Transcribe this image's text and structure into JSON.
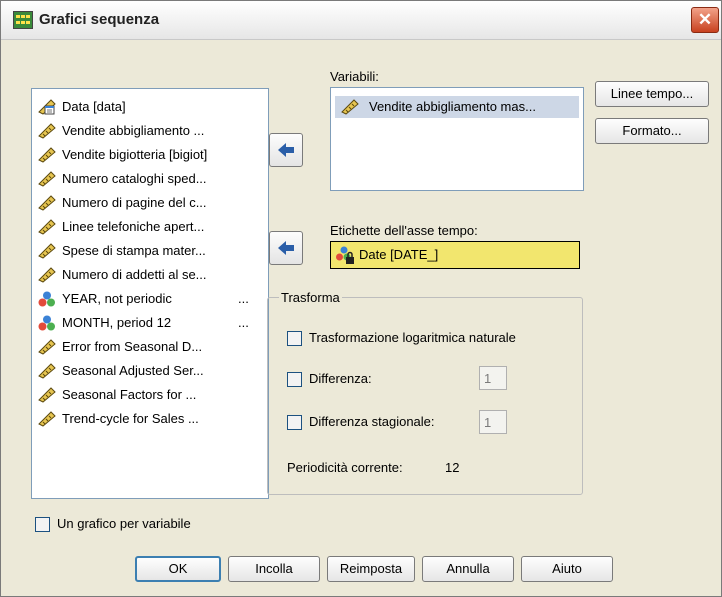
{
  "window": {
    "title": "Grafici sequenza"
  },
  "source_list": {
    "items": [
      {
        "label": "Data [data]",
        "icon": "date-ruler-icon"
      },
      {
        "label": "Vendite abbigliamento ...",
        "icon": "scale-ruler-icon"
      },
      {
        "label": "Vendite bigiotteria [bigiot]",
        "icon": "scale-ruler-icon"
      },
      {
        "label": "Numero cataloghi sped...",
        "icon": "scale-ruler-icon"
      },
      {
        "label": "Numero di pagine del c...",
        "icon": "scale-ruler-icon"
      },
      {
        "label": "Linee telefoniche apert...",
        "icon": "scale-ruler-icon"
      },
      {
        "label": "Spese di stampa mater...",
        "icon": "scale-ruler-icon"
      },
      {
        "label": "Numero di addetti al se...",
        "icon": "scale-ruler-icon"
      },
      {
        "label": "YEAR, not periodic",
        "suffix": "...",
        "icon": "nominal-icon"
      },
      {
        "label": "MONTH, period 12",
        "suffix": "...",
        "icon": "nominal-icon"
      },
      {
        "label": "Error from Seasonal D...",
        "icon": "scale-ruler-icon"
      },
      {
        "label": "Seasonal Adjusted Ser...",
        "icon": "scale-ruler-icon"
      },
      {
        "label": "Seasonal Factors for ...",
        "icon": "scale-ruler-icon"
      },
      {
        "label": "Trend-cycle for Sales ...",
        "icon": "scale-ruler-icon"
      }
    ]
  },
  "variables": {
    "label": "Variabili:",
    "selected": "Vendite abbigliamento mas..."
  },
  "time_axis": {
    "label": "Etichette dell'asse tempo:",
    "value": "Date [DATE_]"
  },
  "side_buttons": {
    "time_lines": "Linee tempo...",
    "format": "Formato..."
  },
  "transform": {
    "title": "Trasforma",
    "natural_log": "Trasformazione logaritmica naturale",
    "difference": "Differenza:",
    "difference_value": "1",
    "seasonal_difference": "Differenza stagionale:",
    "seasonal_difference_value": "1",
    "current_periodicity_label": "Periodicità corrente:",
    "current_periodicity_value": "12"
  },
  "one_chart_per_variable": "Un grafico per variabile",
  "buttons": {
    "ok": "OK",
    "paste": "Incolla",
    "reset": "Reimposta",
    "cancel": "Annulla",
    "help": "Aiuto"
  },
  "colors": {
    "dialog_bg": "#ece9d8",
    "close_button": "#c8411f",
    "selection_bg": "#cdd7e6",
    "time_axis_highlight": "#f2e66e",
    "arrow_blue": "#2a5ea8",
    "default_button_border": "#3c7fb1"
  }
}
